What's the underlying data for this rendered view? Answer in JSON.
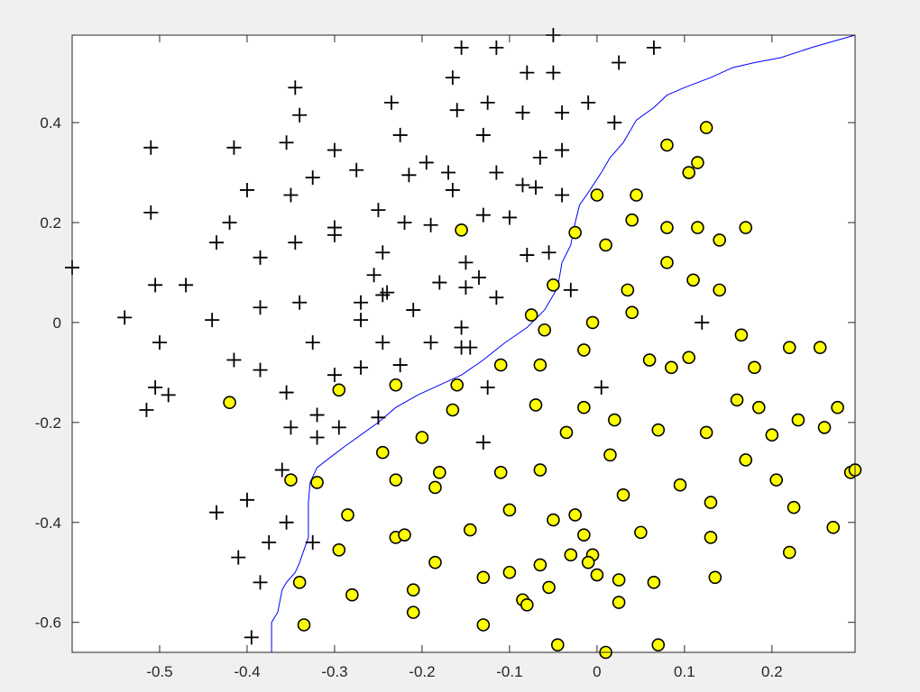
{
  "chart_data": {
    "type": "scatter",
    "title": "",
    "xlabel": "",
    "ylabel": "",
    "xlim": [
      -0.6,
      0.295
    ],
    "ylim": [
      -0.66,
      0.575
    ],
    "xticks": [
      "-0.5",
      "-0.4",
      "-0.3",
      "-0.2",
      "-0.1",
      "0",
      "0.1",
      "0.2"
    ],
    "yticks": [
      "0.4",
      "0.2",
      "0",
      "-0.2",
      "-0.4",
      "-0.6"
    ],
    "grid": false,
    "legend": "none",
    "colors": {
      "positive": "#000000",
      "negative_fill": "#ffff00",
      "negative_edge": "#000000",
      "boundary": "#0000ff",
      "background": "#ffffff",
      "figure_background": "#f0f0f0"
    },
    "series": [
      {
        "marker": "plus",
        "points": [
          [
            -0.6,
            0.11
          ],
          [
            -0.54,
            0.01
          ],
          [
            -0.51,
            0.35
          ],
          [
            -0.51,
            0.22
          ],
          [
            -0.505,
            0.075
          ],
          [
            -0.505,
            -0.13
          ],
          [
            -0.5,
            -0.04
          ],
          [
            -0.49,
            -0.145
          ],
          [
            -0.515,
            -0.175
          ],
          [
            -0.47,
            0.075
          ],
          [
            -0.435,
            0.16
          ],
          [
            -0.44,
            0.005
          ],
          [
            -0.435,
            -0.38
          ],
          [
            -0.415,
            0.35
          ],
          [
            -0.42,
            0.2
          ],
          [
            -0.415,
            -0.075
          ],
          [
            -0.41,
            -0.47
          ],
          [
            -0.4,
            0.265
          ],
          [
            -0.395,
            -0.63
          ],
          [
            -0.4,
            -0.355
          ],
          [
            -0.385,
            0.13
          ],
          [
            -0.385,
            0.03
          ],
          [
            -0.385,
            -0.095
          ],
          [
            -0.385,
            -0.52
          ],
          [
            -0.375,
            -0.44
          ],
          [
            -0.36,
            -0.295
          ],
          [
            -0.355,
            0.36
          ],
          [
            -0.35,
            0.255
          ],
          [
            -0.345,
            0.16
          ],
          [
            -0.34,
            0.04
          ],
          [
            -0.345,
            0.47
          ],
          [
            -0.34,
            0.415
          ],
          [
            -0.355,
            -0.14
          ],
          [
            -0.35,
            -0.21
          ],
          [
            -0.355,
            -0.4
          ],
          [
            -0.325,
            0.29
          ],
          [
            -0.325,
            -0.04
          ],
          [
            -0.32,
            -0.185
          ],
          [
            -0.32,
            -0.23
          ],
          [
            -0.325,
            -0.44
          ],
          [
            -0.3,
            0.345
          ],
          [
            -0.3,
            0.19
          ],
          [
            -0.3,
            0.175
          ],
          [
            -0.3,
            -0.105
          ],
          [
            -0.295,
            -0.21
          ],
          [
            -0.275,
            0.305
          ],
          [
            -0.27,
            0.04
          ],
          [
            -0.27,
            0.005
          ],
          [
            -0.27,
            -0.09
          ],
          [
            -0.255,
            0.095
          ],
          [
            -0.25,
            0.225
          ],
          [
            -0.245,
            0.14
          ],
          [
            -0.245,
            0.055
          ],
          [
            -0.24,
            0.06
          ],
          [
            -0.245,
            -0.04
          ],
          [
            -0.25,
            -0.19
          ],
          [
            -0.235,
            0.44
          ],
          [
            -0.225,
            0.375
          ],
          [
            -0.215,
            0.295
          ],
          [
            -0.22,
            0.2
          ],
          [
            -0.21,
            0.025
          ],
          [
            -0.225,
            -0.085
          ],
          [
            -0.195,
            0.32
          ],
          [
            -0.19,
            0.195
          ],
          [
            -0.19,
            -0.04
          ],
          [
            -0.18,
            0.08
          ],
          [
            -0.165,
            0.49
          ],
          [
            -0.16,
            0.425
          ],
          [
            -0.17,
            0.3
          ],
          [
            -0.165,
            0.265
          ],
          [
            -0.155,
            0.55
          ],
          [
            -0.15,
            0.12
          ],
          [
            -0.15,
            0.07
          ],
          [
            -0.155,
            -0.01
          ],
          [
            -0.155,
            -0.05
          ],
          [
            -0.145,
            -0.05
          ],
          [
            -0.135,
            0.09
          ],
          [
            -0.13,
            0.375
          ],
          [
            -0.125,
            0.44
          ],
          [
            -0.13,
            0.215
          ],
          [
            -0.125,
            -0.13
          ],
          [
            -0.13,
            -0.24
          ],
          [
            -0.115,
            0.55
          ],
          [
            -0.115,
            0.3
          ],
          [
            -0.115,
            0.05
          ],
          [
            -0.1,
            0.21
          ],
          [
            -0.085,
            0.42
          ],
          [
            -0.085,
            0.275
          ],
          [
            -0.08,
            0.135
          ],
          [
            -0.08,
            0.5
          ],
          [
            -0.07,
            0.27
          ],
          [
            -0.065,
            0.33
          ],
          [
            -0.055,
            0.14
          ],
          [
            -0.05,
            0.575
          ],
          [
            -0.05,
            0.5
          ],
          [
            -0.04,
            0.42
          ],
          [
            -0.04,
            0.345
          ],
          [
            -0.04,
            0.255
          ],
          [
            -0.03,
            0.065
          ],
          [
            -0.01,
            0.44
          ],
          [
            0.005,
            -0.13
          ],
          [
            0.02,
            0.4
          ],
          [
            0.025,
            0.52
          ],
          [
            0.065,
            0.55
          ],
          [
            0.12,
            0.0
          ]
        ]
      },
      {
        "marker": "circle",
        "points": [
          [
            -0.42,
            -0.16
          ],
          [
            -0.35,
            -0.315
          ],
          [
            -0.32,
            -0.32
          ],
          [
            -0.34,
            -0.52
          ],
          [
            -0.335,
            -0.605
          ],
          [
            -0.295,
            -0.135
          ],
          [
            -0.295,
            -0.455
          ],
          [
            -0.285,
            -0.385
          ],
          [
            -0.28,
            -0.545
          ],
          [
            -0.23,
            -0.125
          ],
          [
            -0.23,
            -0.315
          ],
          [
            -0.245,
            -0.26
          ],
          [
            -0.23,
            -0.43
          ],
          [
            -0.22,
            -0.425
          ],
          [
            -0.21,
            -0.535
          ],
          [
            -0.21,
            -0.58
          ],
          [
            -0.2,
            -0.23
          ],
          [
            -0.185,
            -0.33
          ],
          [
            -0.18,
            -0.3
          ],
          [
            -0.185,
            -0.48
          ],
          [
            -0.165,
            -0.175
          ],
          [
            -0.16,
            -0.125
          ],
          [
            -0.155,
            0.185
          ],
          [
            -0.145,
            -0.415
          ],
          [
            -0.13,
            -0.51
          ],
          [
            -0.13,
            -0.605
          ],
          [
            -0.11,
            -0.085
          ],
          [
            -0.11,
            -0.3
          ],
          [
            -0.1,
            -0.375
          ],
          [
            -0.1,
            -0.5
          ],
          [
            -0.075,
            0.015
          ],
          [
            -0.07,
            -0.165
          ],
          [
            -0.065,
            -0.085
          ],
          [
            -0.065,
            -0.295
          ],
          [
            -0.065,
            -0.485
          ],
          [
            -0.06,
            -0.015
          ],
          [
            -0.055,
            -0.53
          ],
          [
            -0.05,
            0.075
          ],
          [
            -0.05,
            -0.395
          ],
          [
            -0.085,
            -0.555
          ],
          [
            -0.08,
            -0.565
          ],
          [
            -0.045,
            -0.645
          ],
          [
            -0.035,
            -0.22
          ],
          [
            -0.025,
            0.18
          ],
          [
            -0.025,
            -0.385
          ],
          [
            -0.03,
            -0.465
          ],
          [
            -0.015,
            -0.17
          ],
          [
            -0.015,
            -0.425
          ],
          [
            -0.015,
            -0.055
          ],
          [
            -0.005,
            -0.465
          ],
          [
            -0.01,
            -0.48
          ],
          [
            0.0,
            0.255
          ],
          [
            -0.005,
            0.0
          ],
          [
            0.0,
            -0.505
          ],
          [
            0.01,
            0.155
          ],
          [
            0.01,
            -0.66
          ],
          [
            0.02,
            -0.195
          ],
          [
            0.015,
            -0.265
          ],
          [
            0.025,
            -0.515
          ],
          [
            0.025,
            -0.56
          ],
          [
            0.03,
            -0.345
          ],
          [
            0.035,
            0.065
          ],
          [
            0.04,
            0.205
          ],
          [
            0.04,
            0.02
          ],
          [
            0.045,
            0.255
          ],
          [
            0.05,
            -0.42
          ],
          [
            0.06,
            -0.075
          ],
          [
            0.065,
            -0.52
          ],
          [
            0.07,
            -0.645
          ],
          [
            0.07,
            -0.215
          ],
          [
            0.08,
            0.355
          ],
          [
            0.08,
            0.19
          ],
          [
            0.08,
            0.12
          ],
          [
            0.085,
            -0.09
          ],
          [
            0.095,
            -0.325
          ],
          [
            0.105,
            -0.07
          ],
          [
            0.105,
            0.3
          ],
          [
            0.11,
            0.085
          ],
          [
            0.115,
            0.32
          ],
          [
            0.115,
            0.19
          ],
          [
            0.125,
            0.39
          ],
          [
            0.125,
            -0.22
          ],
          [
            0.13,
            -0.43
          ],
          [
            0.13,
            -0.36
          ],
          [
            0.135,
            -0.51
          ],
          [
            0.14,
            0.165
          ],
          [
            0.14,
            0.065
          ],
          [
            0.16,
            -0.155
          ],
          [
            0.165,
            -0.025
          ],
          [
            0.17,
            0.19
          ],
          [
            0.17,
            -0.275
          ],
          [
            0.18,
            -0.09
          ],
          [
            0.185,
            -0.17
          ],
          [
            0.2,
            -0.225
          ],
          [
            0.205,
            -0.315
          ],
          [
            0.22,
            -0.46
          ],
          [
            0.22,
            -0.05
          ],
          [
            0.225,
            -0.37
          ],
          [
            0.23,
            -0.195
          ],
          [
            0.255,
            -0.05
          ],
          [
            0.26,
            -0.21
          ],
          [
            0.27,
            -0.41
          ],
          [
            0.275,
            -0.17
          ],
          [
            0.29,
            -0.3
          ],
          [
            0.295,
            -0.295
          ]
        ]
      }
    ],
    "boundary": [
      [
        -0.372,
        -0.66
      ],
      [
        -0.372,
        -0.6
      ],
      [
        -0.365,
        -0.58
      ],
      [
        -0.36,
        -0.535
      ],
      [
        -0.355,
        -0.52
      ],
      [
        -0.345,
        -0.5
      ],
      [
        -0.34,
        -0.48
      ],
      [
        -0.335,
        -0.455
      ],
      [
        -0.33,
        -0.43
      ],
      [
        -0.33,
        -0.36
      ],
      [
        -0.328,
        -0.32
      ],
      [
        -0.32,
        -0.29
      ],
      [
        -0.305,
        -0.27
      ],
      [
        -0.29,
        -0.25
      ],
      [
        -0.27,
        -0.225
      ],
      [
        -0.25,
        -0.2
      ],
      [
        -0.23,
        -0.17
      ],
      [
        -0.205,
        -0.145
      ],
      [
        -0.18,
        -0.125
      ],
      [
        -0.155,
        -0.105
      ],
      [
        -0.13,
        -0.075
      ],
      [
        -0.105,
        -0.04
      ],
      [
        -0.08,
        -0.01
      ],
      [
        -0.06,
        0.025
      ],
      [
        -0.045,
        0.07
      ],
      [
        -0.04,
        0.12
      ],
      [
        -0.03,
        0.155
      ],
      [
        -0.025,
        0.2
      ],
      [
        -0.02,
        0.235
      ],
      [
        -0.01,
        0.26
      ],
      [
        0.005,
        0.3
      ],
      [
        0.015,
        0.33
      ],
      [
        0.03,
        0.36
      ],
      [
        0.045,
        0.405
      ],
      [
        0.065,
        0.43
      ],
      [
        0.08,
        0.455
      ],
      [
        0.1,
        0.47
      ],
      [
        0.13,
        0.49
      ],
      [
        0.155,
        0.51
      ],
      [
        0.18,
        0.52
      ],
      [
        0.21,
        0.53
      ],
      [
        0.245,
        0.55
      ],
      [
        0.275,
        0.565
      ],
      [
        0.295,
        0.575
      ]
    ]
  }
}
